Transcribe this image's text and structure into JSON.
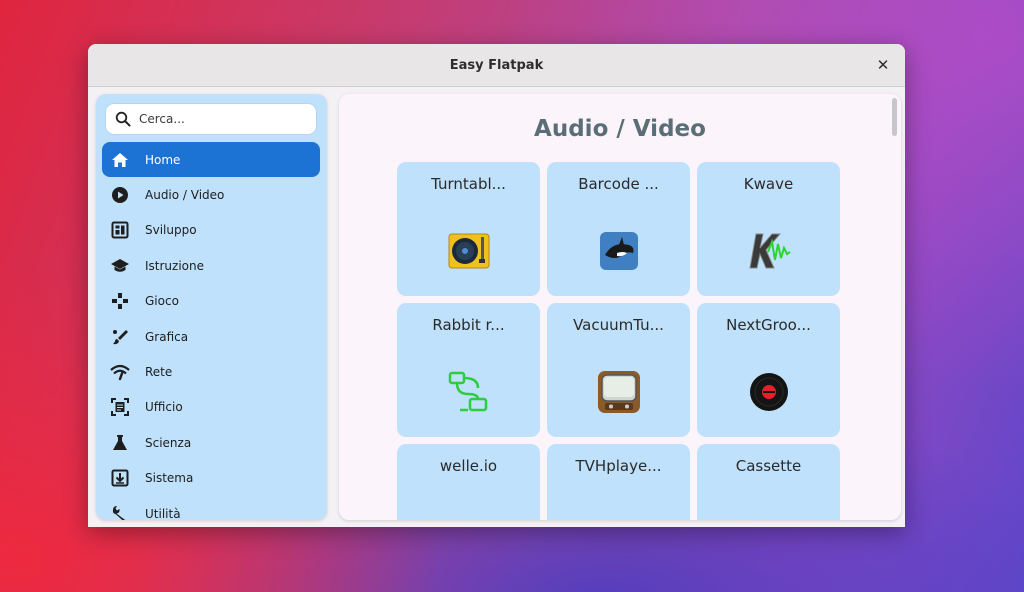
{
  "window": {
    "title": "Easy Flatpak"
  },
  "search": {
    "placeholder": "Cerca..."
  },
  "sidebar": {
    "items": [
      {
        "label": "Home",
        "icon": "home-icon",
        "active": true
      },
      {
        "label": "Audio / Video",
        "icon": "play-circle-icon",
        "active": false
      },
      {
        "label": "Sviluppo",
        "icon": "code-window-icon",
        "active": false
      },
      {
        "label": "Istruzione",
        "icon": "graduation-cap-icon",
        "active": false
      },
      {
        "label": "Gioco",
        "icon": "gamepad-icon",
        "active": false
      },
      {
        "label": "Grafica",
        "icon": "paint-brush-icon",
        "active": false
      },
      {
        "label": "Rete",
        "icon": "wifi-icon",
        "active": false
      },
      {
        "label": "Ufficio",
        "icon": "document-icon",
        "active": false
      },
      {
        "label": "Scienza",
        "icon": "flask-icon",
        "active": false
      },
      {
        "label": "Sistema",
        "icon": "system-download-icon",
        "active": false
      },
      {
        "label": "Utilità",
        "icon": "wrench-icon",
        "active": false
      }
    ]
  },
  "main": {
    "heading": "Audio / Video",
    "apps": [
      {
        "name": "Turntabl...",
        "icon": "turntable-icon"
      },
      {
        "name": "Barcode ...",
        "icon": "barcode-orca-icon"
      },
      {
        "name": "Kwave",
        "icon": "kwave-icon"
      },
      {
        "name": "Rabbit r...",
        "icon": "rabbit-remote-icon"
      },
      {
        "name": "VacuumTu...",
        "icon": "vacuum-tube-tv-icon"
      },
      {
        "name": "NextGroo...",
        "icon": "vinyl-record-icon"
      },
      {
        "name": "welle.io",
        "icon": "radio-icon"
      },
      {
        "name": "TVHplaye...",
        "icon": "tv-player-icon"
      },
      {
        "name": "Cassette",
        "icon": "cassette-icon"
      }
    ]
  },
  "colors": {
    "accent": "#1c73d4",
    "sidebar_bg": "#bfe1fb",
    "card_bg": "#bfe1fb",
    "heading": "#5b6e78"
  }
}
